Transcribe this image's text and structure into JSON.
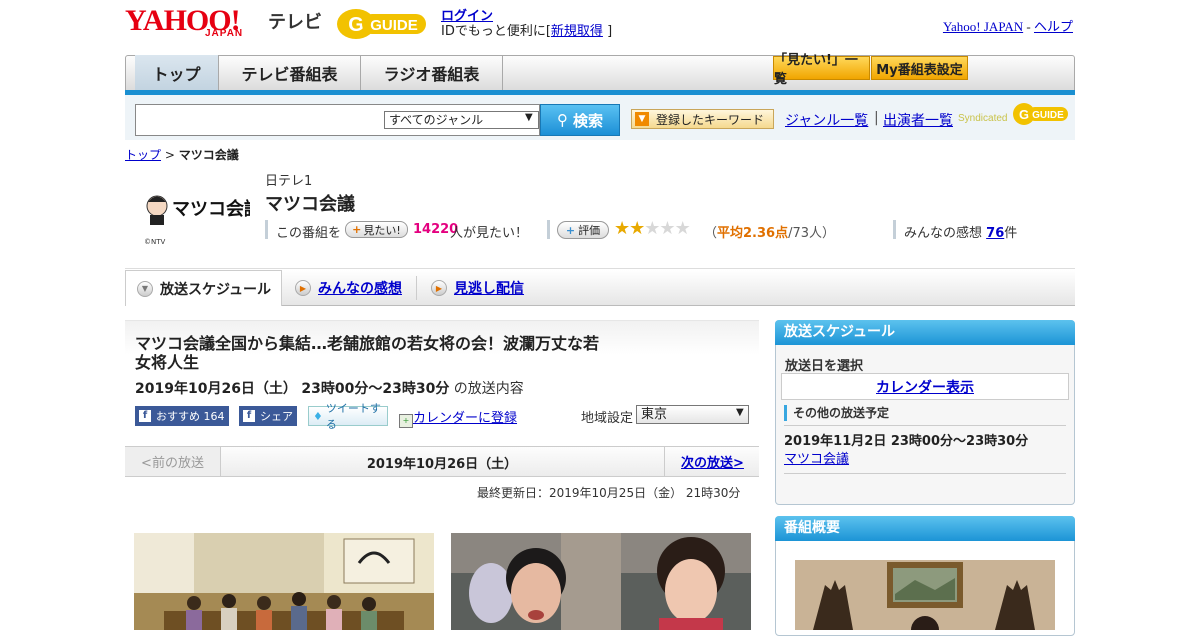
{
  "header": {
    "yahoo_logo": "YAHOO!",
    "japan_logo": "JAPAN",
    "tv_label": "テレビ",
    "gguide_logo": "GUIDE",
    "login": "ログイン",
    "id_text": "IDでもっと便利に[",
    "signup": "新規取得",
    "id_close": "]",
    "yahoo_japan_link": "Yahoo! JAPAN",
    "dash": "-",
    "help_link": "ヘルプ"
  },
  "nav": {
    "tabs": [
      "トップ",
      "テレビ番組表",
      "ラジオ番組表"
    ],
    "mitai_list": "「見たい!」一覧",
    "my_schedule": "My番組表設定"
  },
  "search": {
    "genre_selected": "すべてのジャンル",
    "search_button": "検索",
    "keyword_button": "登録したキーワード",
    "genre_list": "ジャンル一覧",
    "separator": "|",
    "cast_list": "出演者一覧",
    "syndicated": "Syndicated",
    "gguide_small": "GUIDE"
  },
  "breadcrumb": {
    "top": "トップ",
    "sep": ">",
    "current": "マツコ会議"
  },
  "program": {
    "logo_text": "マツコ会議",
    "copyright": "©NTV",
    "channel": "日テレ1",
    "title": "マツコ会議",
    "mitai_prefix": "この番組を",
    "mitai_button": "見たい!",
    "mitai_count": "14220",
    "mitai_suffix": "人が見たい！",
    "rating_button": "評価",
    "rating_stars": 2,
    "rating_max": 5,
    "avg_open": "（",
    "avg_value": "平均2.36点",
    "avg_people": "/73人）",
    "review_prefix": "みんなの感想",
    "review_count": "76",
    "review_suffix": "件"
  },
  "tabs": {
    "schedule": "放送スケジュール",
    "reviews": "みんなの感想",
    "vod": "見逃し配信"
  },
  "episode": {
    "title": "マツコ会議全国から集結…老舗旅館の若女将の会！波瀾万丈な若女将人生",
    "date": "2019年10月26日（土）",
    "time": "23時00分～23時30分",
    "date_suffix": "の放送内容",
    "fb_recommend": "おすすめ",
    "fb_count": "164",
    "fb_share": "シェア",
    "tweet": "ツイートする",
    "calendar_register": "カレンダーに登録",
    "region_label": "地域設定",
    "region_value": "東京"
  },
  "pager": {
    "prev": "<前の放送",
    "current": "2019年10月26日（土）",
    "next": "次の放送>"
  },
  "updated": "最終更新日：2019年10月25日（金） 21時30分",
  "sidebar": {
    "schedule_header": "放送スケジュール",
    "select_day": "放送日を選択",
    "calendar_button": "カレンダー表示",
    "other_schedule": "その他の放送予定",
    "other_date": "2019年11月2日 23時00分～23時30分",
    "other_link": "マツコ会議",
    "overview_header": "番組概要"
  },
  "colors": {
    "brand_red": "#e60012",
    "accent_blue": "#1a8fd1",
    "gguide_yellow": "#f2c200",
    "mitai_pink": "#e4007f"
  }
}
